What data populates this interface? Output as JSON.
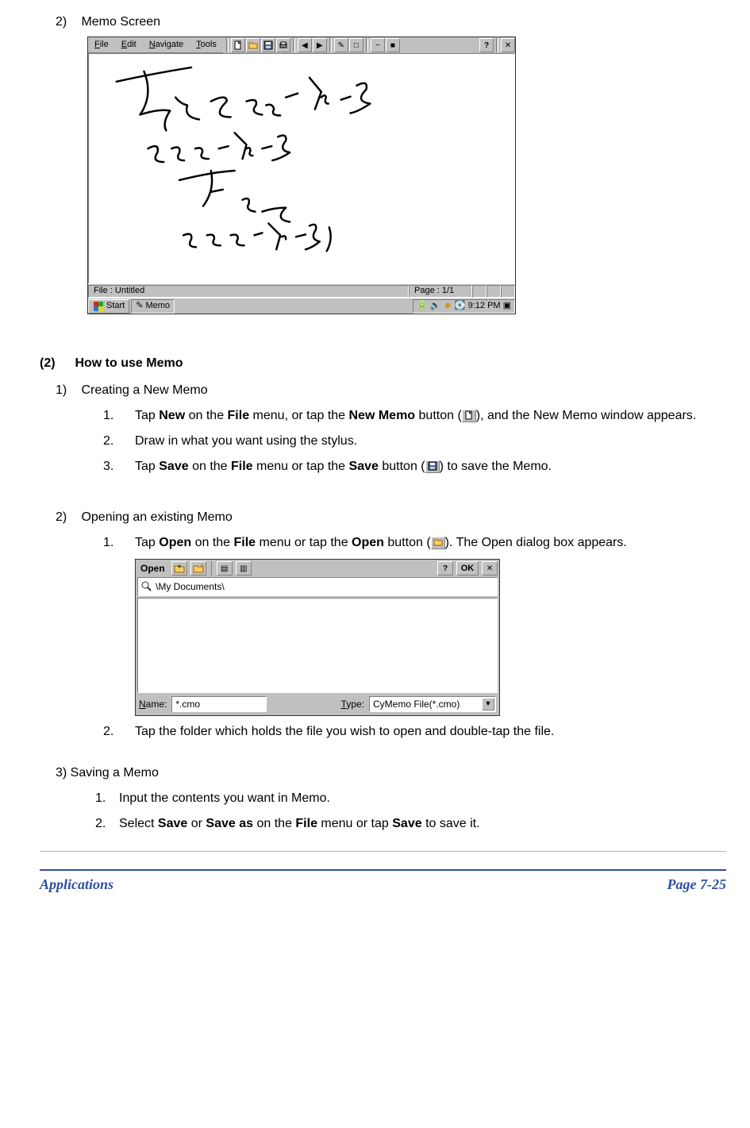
{
  "top": {
    "num": "2)",
    "title": "Memo Screen"
  },
  "memo_app": {
    "menus": [
      {
        "underline": "F",
        "rest": "ile"
      },
      {
        "underline": "E",
        "rest": "dit"
      },
      {
        "underline": "N",
        "rest": "avigate"
      },
      {
        "underline": "T",
        "rest": "ools"
      }
    ],
    "status_file": "File : Untitled",
    "status_page": "Page : 1/1",
    "taskbar_start": "Start",
    "taskbar_memo": "Memo",
    "tray_time": "9:12 PM"
  },
  "section2": {
    "num": "(2)",
    "title": "How to use Memo",
    "sub1": {
      "num": "1)",
      "title": "Creating a New Memo"
    },
    "steps1": {
      "s1a": "Tap ",
      "s1b": "New",
      "s1c": " on the ",
      "s1d": "File",
      "s1e": " menu, or tap the ",
      "s1f": "New Memo",
      "s1g": " button (",
      "s1h": "), and the New Memo window appears.",
      "s2": "Draw in what you want using the stylus.",
      "s3a": "Tap ",
      "s3b": "Save",
      "s3c": " on the ",
      "s3d": "File",
      "s3e": " menu or tap the ",
      "s3f": "Save",
      "s3g": " button (",
      "s3h": ") to save the Memo."
    },
    "sub2": {
      "num": "2)",
      "title": "Opening an existing Memo"
    },
    "steps2": {
      "s1a": "Tap ",
      "s1b": "Open",
      "s1c": " on the ",
      "s1d": "File",
      "s1e": " menu or tap the ",
      "s1f": "Open",
      "s1g": " button (",
      "s1h": "). The Open dialog box appears.",
      "s2": "Tap the folder which holds the file you wish to open and double-tap the file."
    },
    "sub3": {
      "title": "3) Saving a Memo"
    },
    "steps3": {
      "s1": "Input the contents you want in Memo.",
      "s2a": "Select ",
      "s2b": "Save",
      "s2c": " or ",
      "s2d": "Save as",
      "s2e": " on the ",
      "s2f": "File",
      "s2g": " menu or tap ",
      "s2h": "Save",
      "s2i": " to save it."
    }
  },
  "open_dialog": {
    "title": "Open",
    "ok": "OK",
    "path": "\\My Documents\\",
    "name_label_u": "N",
    "name_label_rest": "ame:",
    "name_value": "*.cmo",
    "type_label_u": "T",
    "type_label_rest": "ype:",
    "type_value": "CyMemo File(*.cmo)"
  },
  "footer": {
    "left": "Applications",
    "right": "Page 7-25"
  }
}
